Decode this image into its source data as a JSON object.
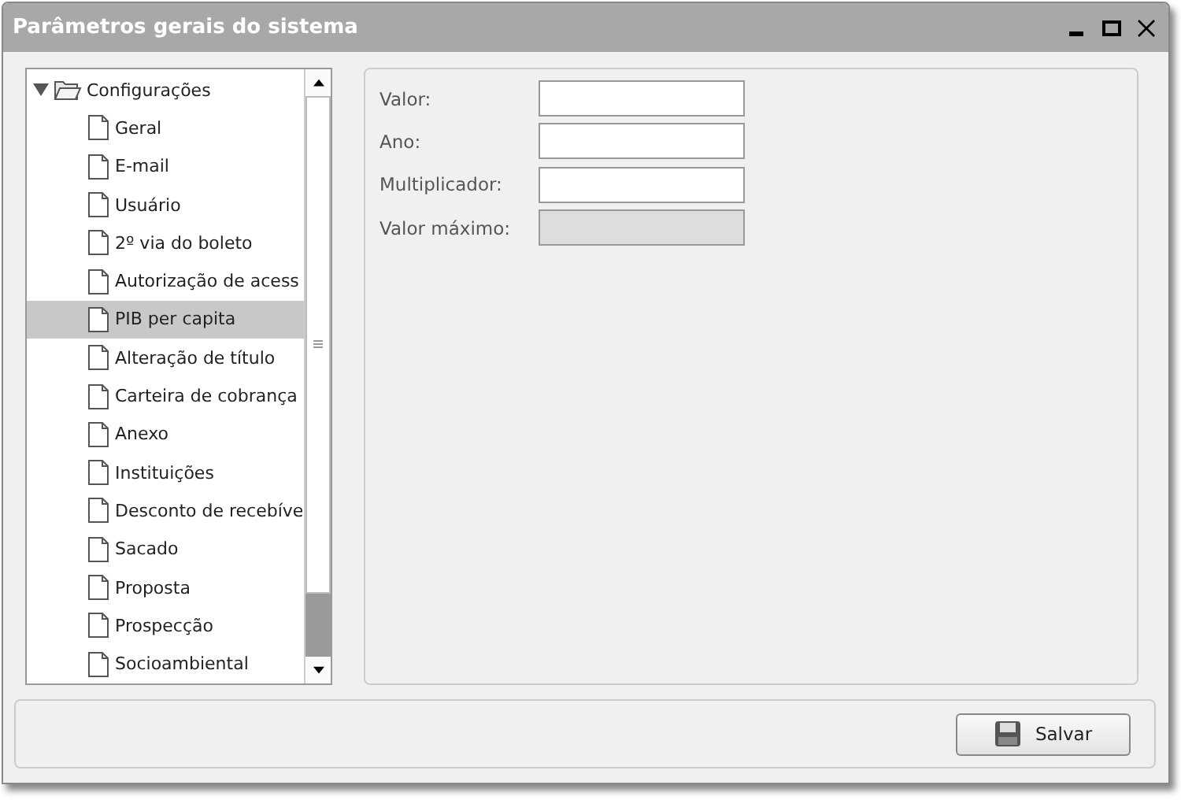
{
  "window": {
    "title": "Parâmetros gerais do sistema"
  },
  "tree": {
    "label": "Configurações",
    "expanded": true,
    "children": [
      {
        "label": "Geral",
        "selected": false
      },
      {
        "label": "E-mail",
        "selected": false
      },
      {
        "label": "Usuário",
        "selected": false
      },
      {
        "label": "2º via do boleto",
        "selected": false
      },
      {
        "label": "Autorização de acess",
        "selected": false
      },
      {
        "label": "PIB per capita",
        "selected": true
      },
      {
        "label": "Alteração de título",
        "selected": false
      },
      {
        "label": "Carteira de cobrança",
        "selected": false
      },
      {
        "label": "Anexo",
        "selected": false
      },
      {
        "label": "Instituições",
        "selected": false
      },
      {
        "label": "Desconto de recebíve",
        "selected": false
      },
      {
        "label": "Sacado",
        "selected": false
      },
      {
        "label": "Proposta",
        "selected": false
      },
      {
        "label": "Prospecção",
        "selected": false
      },
      {
        "label": "Socioambiental",
        "selected": false
      }
    ]
  },
  "form": {
    "fields": [
      {
        "label": "Valor:",
        "disabled": false
      },
      {
        "label": "Ano:",
        "disabled": false
      },
      {
        "label": "Multiplicador:",
        "disabled": false
      },
      {
        "label": "Valor máximo:",
        "disabled": true
      }
    ]
  },
  "buttons": [
    "Salvar"
  ]
}
